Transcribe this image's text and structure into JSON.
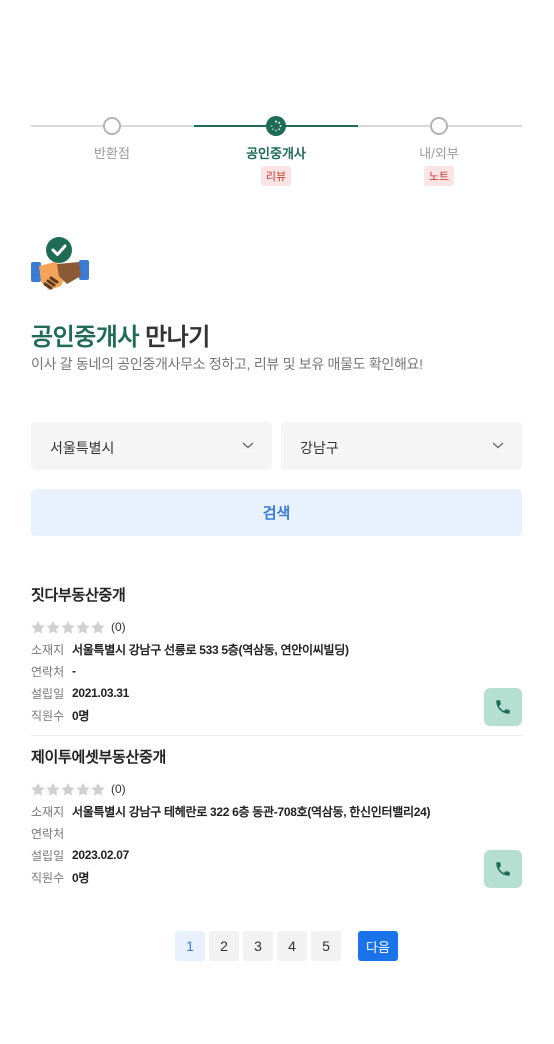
{
  "stepper": {
    "steps": [
      {
        "label": "반환점",
        "badge": ""
      },
      {
        "label": "공인중개사",
        "badge": "리뷰"
      },
      {
        "label": "내/외부",
        "badge": "노트"
      }
    ]
  },
  "hero": {
    "icon": "handshake-check-icon",
    "title_accent": "공인중개사",
    "title_rest": " 만나기",
    "subtitle": "이사 갈 동네의 공인중개사무소 정하고, 리뷰 및 보유 매물도 확인해요!"
  },
  "filters": {
    "city": "서울특별시",
    "district": "강남구",
    "search_label": "검색"
  },
  "labels": {
    "address": "소재지",
    "contact": "연락처",
    "founded": "설립일",
    "staff": "직원수"
  },
  "listings": [
    {
      "name": "짓다부동산중개",
      "rating_count": "(0)",
      "address": "서울특별시 강남구 선릉로 533 5층(역삼동, 연안이씨빌딩)",
      "contact": "-",
      "founded": "2021.03.31",
      "staff": "0명"
    },
    {
      "name": "제이투에셋부동산중개",
      "rating_count": "(0)",
      "address": "서울특별시 강남구 테헤란로 322 6층 동관-708호(역삼동, 한신인터밸리24)",
      "contact": "",
      "founded": "2023.02.07",
      "staff": "0명"
    }
  ],
  "pagination": {
    "pages": [
      "1",
      "2",
      "3",
      "4",
      "5"
    ],
    "current": "1",
    "next_label": "다음"
  },
  "colors": {
    "accent_green": "#1f6b55",
    "call_bg": "#b5e0d1",
    "primary_blue": "#1a73e8",
    "badge_red": "#c0392b"
  }
}
